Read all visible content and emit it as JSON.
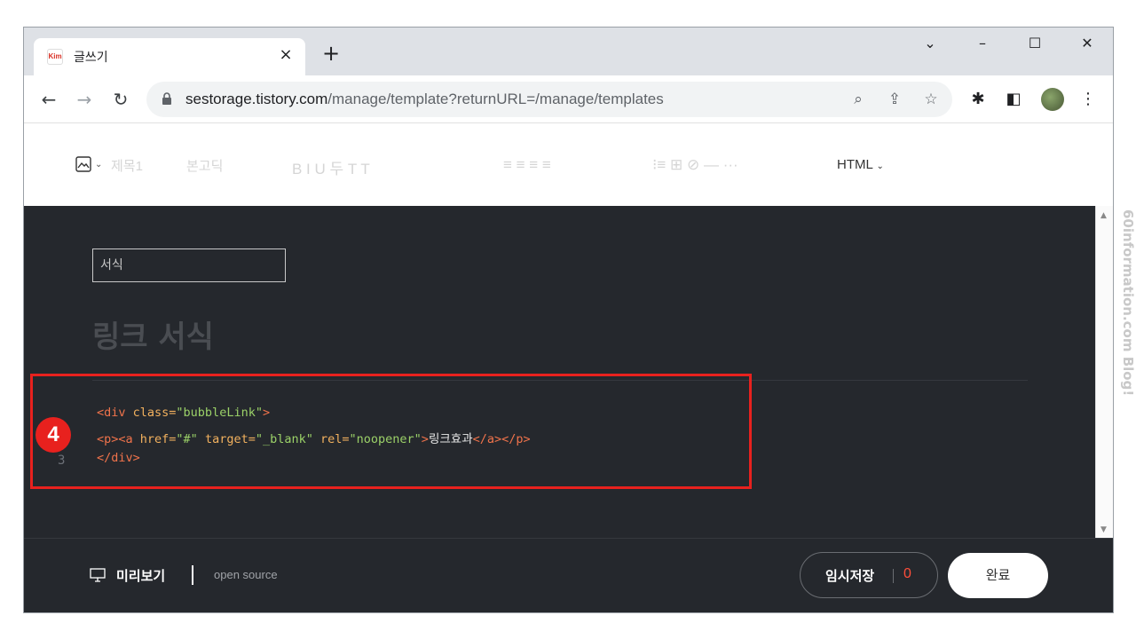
{
  "browser": {
    "tab_title": "글쓰기",
    "favicon_text": "Kim",
    "tab_close": "×",
    "new_tab": "+",
    "url_host": "sestorage.tistory.com",
    "url_path": "/manage/template?returnURL=/manage/templates",
    "window_controls": {
      "dropdown": "⌄",
      "minimize": "–",
      "maximize": "☐",
      "close": "✕"
    }
  },
  "editor_toolbar": {
    "heading": "제목1",
    "paragraph": "본고딕",
    "format_glyphs": "B  I  U  두  T  T",
    "align_glyphs": "≡  ≡  ≡  ≡",
    "insert_glyphs": "⁝≡  ⊞  ⊘  —  ···",
    "mode": "HTML"
  },
  "editor": {
    "title_field_value": "서식",
    "post_title": "링크 서식",
    "line_numbers": [
      "3"
    ],
    "code": {
      "line1_tag": "<div ",
      "line1_attr": "class=",
      "line1_str": "\"bubbleLink\"",
      "line1_end": ">",
      "line2_tag1": "<p><a ",
      "line2_attr1": "href=",
      "line2_str1": "\"#\"",
      "line2_attr2": " target=",
      "line2_str2": "\"_blank\"",
      "line2_attr3": " rel=",
      "line2_str3": "\"noopener\"",
      "line2_gt": ">",
      "line2_text": "링크효과",
      "line2_close": "</a></p>",
      "line3": "</div>"
    },
    "step_badge": "4"
  },
  "footer": {
    "preview": "미리보기",
    "open_source": "open source",
    "draft_label": "임시저장",
    "draft_count": "0",
    "done": "완료"
  },
  "watermark": "60information.com  Blog!",
  "colors": {
    "editor_bg": "#25282d",
    "highlight_red": "#e8211e",
    "tag": "#f0734b",
    "string": "#9bd168",
    "attribute": "#f2b15e"
  }
}
